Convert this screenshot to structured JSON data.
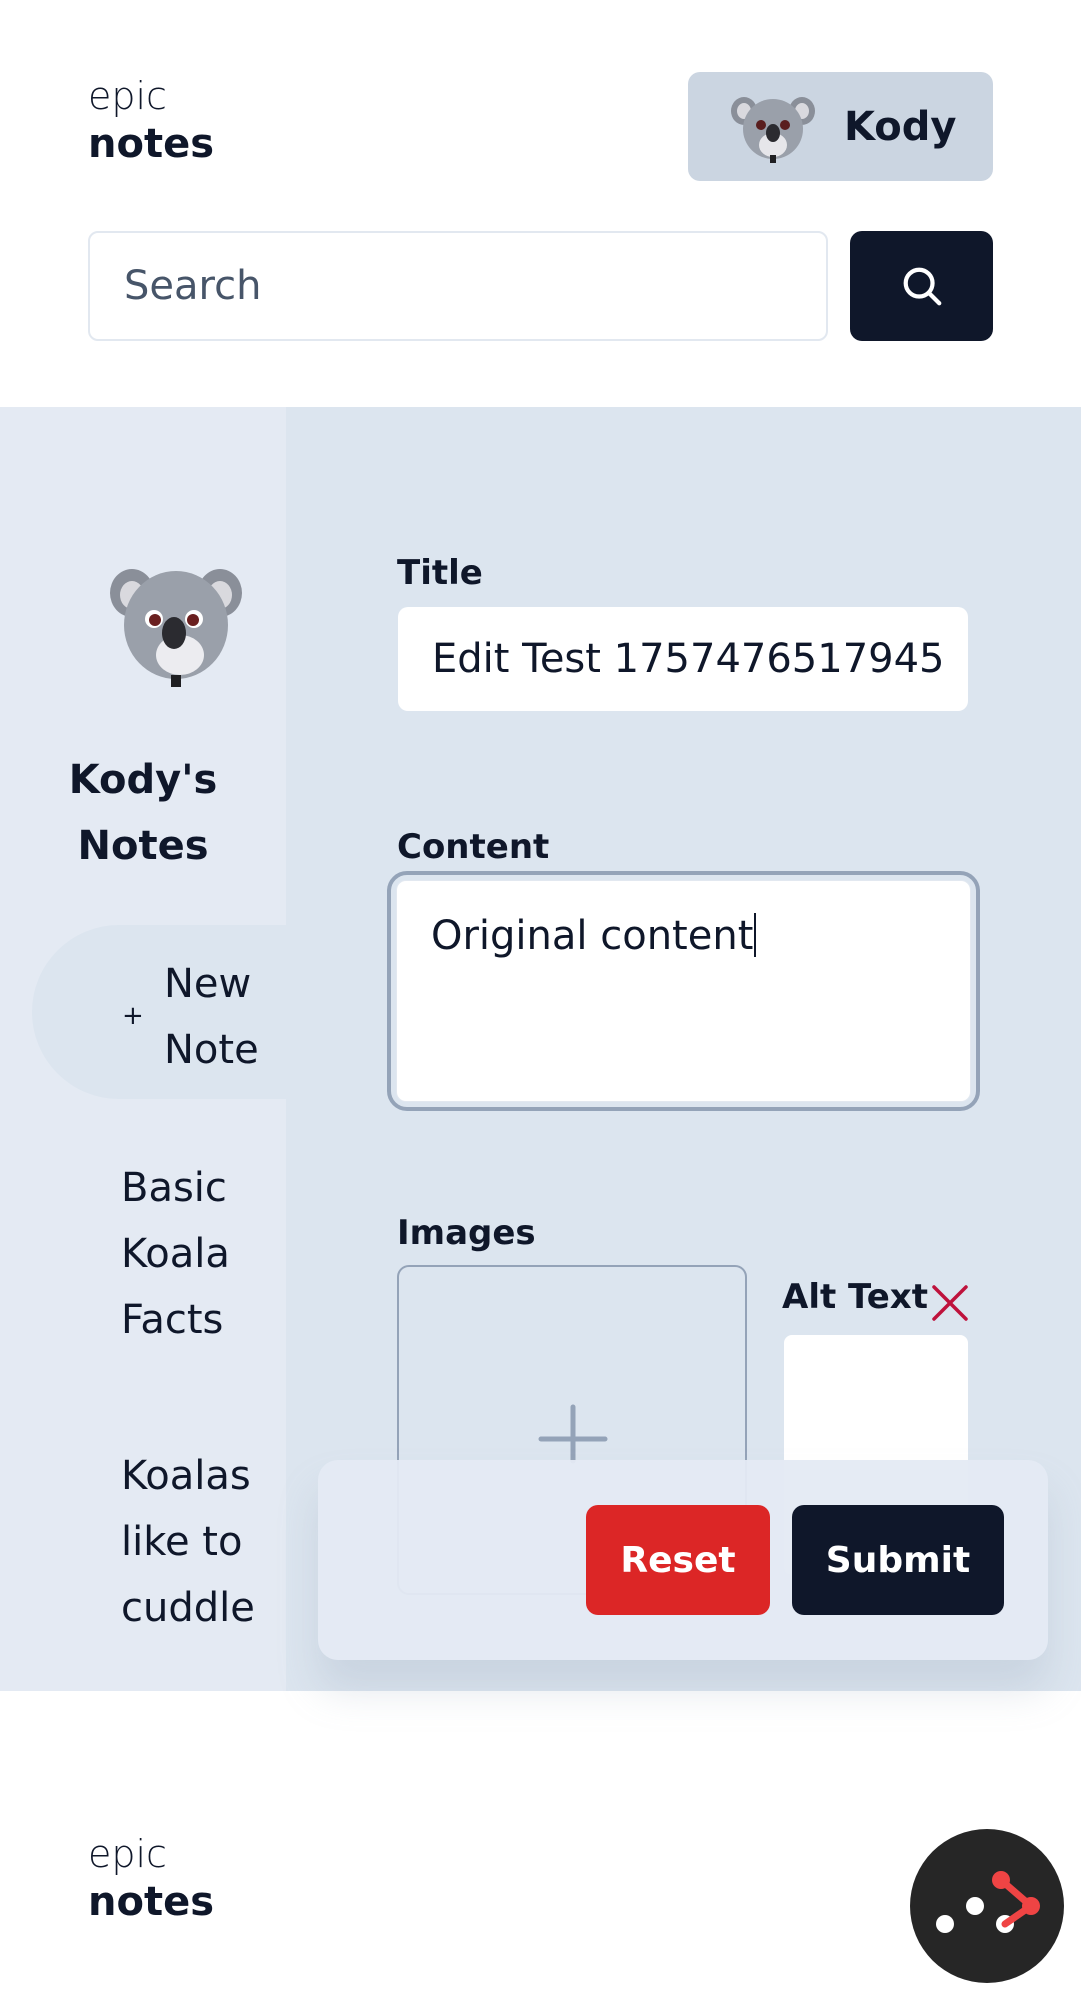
{
  "header": {
    "logo_line1": "epic",
    "logo_line2": "notes",
    "user_name": "Kody"
  },
  "search": {
    "placeholder": "Search",
    "value": ""
  },
  "sidebar": {
    "owner_title": "Kody's Notes",
    "new_note_label": "New Note",
    "new_note_icon": "+",
    "notes": [
      {
        "title": "Basic Koala Facts"
      },
      {
        "title": "Koalas like to cuddle"
      }
    ]
  },
  "editor": {
    "title_label": "Title",
    "title_value": "Edit Test 1757476517945",
    "content_label": "Content",
    "content_value": "Original content",
    "images_label": "Images",
    "alt_text_label": "Alt Text",
    "reset_label": "Reset",
    "submit_label": "Submit"
  },
  "footer": {
    "logo_line1": "epic",
    "logo_line2": "notes"
  },
  "colors": {
    "primary": "#0f172a",
    "destructive": "#dc2626",
    "panel": "#dce5ef",
    "sidebar": "#e4eaf3"
  }
}
